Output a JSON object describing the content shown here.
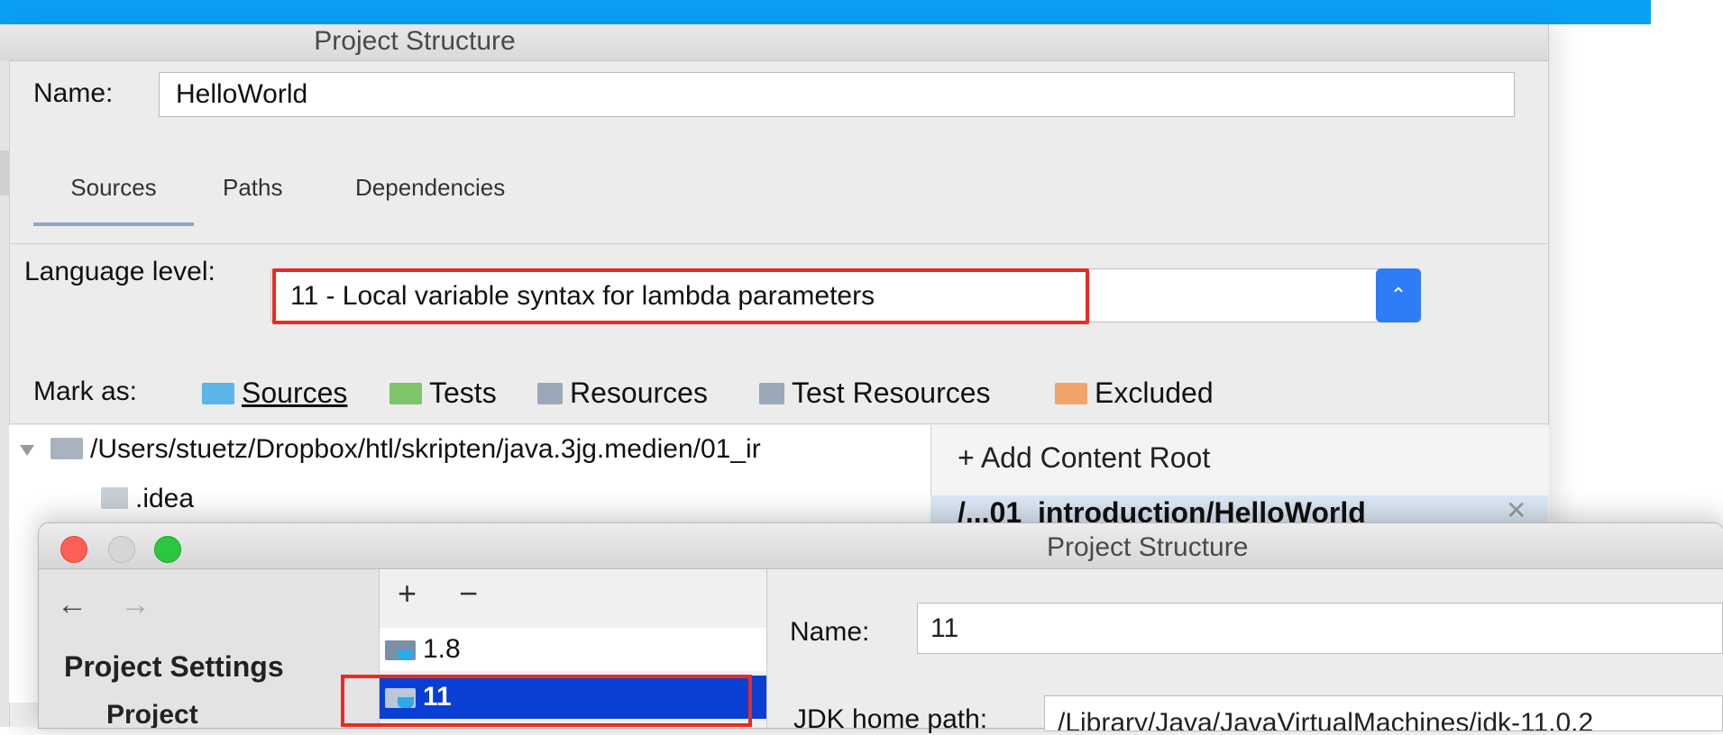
{
  "background_window": {
    "title": "Project Structure",
    "name_label": "Name:",
    "name_value": "HelloWorld",
    "tabs": [
      {
        "label": "Sources",
        "active": true
      },
      {
        "label": "Paths",
        "active": false
      },
      {
        "label": "Dependencies",
        "active": false
      }
    ],
    "language_level": {
      "label": "Language level:",
      "value": "11 - Local variable syntax for lambda parameters"
    },
    "mark_as": {
      "label": "Mark as:",
      "items": [
        {
          "label": "Sources",
          "color": "#5bb5e8"
        },
        {
          "label": "Tests",
          "color": "#7dc46a"
        },
        {
          "label": "Resources",
          "color": "#9aa8b8"
        },
        {
          "label": "Test Resources",
          "color": "#9aa8b8"
        },
        {
          "label": "Excluded",
          "color": "#f0a46a"
        }
      ]
    },
    "tree": [
      {
        "label": "/Users/stuetz/Dropbox/htl/skripten/java.3jg.medien/01_ir",
        "expanded": true
      },
      {
        "label": ".idea"
      }
    ],
    "content_root": {
      "add_label": "+ Add Content Root",
      "path": "/...01_introduction/HelloWorld",
      "remove_icon": "close-icon"
    }
  },
  "foreground_window": {
    "title": "Project Structure",
    "traffic_lights": {
      "close": "#fc5f57",
      "minimize": "#d6d6d6",
      "maximize": "#2ac840"
    },
    "nav": {
      "back": "←",
      "forward": "→",
      "section": "Project Settings",
      "item": "Project"
    },
    "sdk_list": {
      "add": "+",
      "remove": "−",
      "items": [
        {
          "label": "1.8",
          "selected": false
        },
        {
          "label": "11",
          "selected": true
        }
      ]
    },
    "details": {
      "name_label": "Name:",
      "name_value": "11",
      "jdk_home_label": "JDK home path:",
      "jdk_home_value": "/Library/Java/JavaVirtualMachines/jdk-11.0.2"
    }
  },
  "colors": {
    "accent_bar": "#0aa0f5",
    "highlight_box": "#ea2b1f",
    "selection": "#0a3fd4",
    "stepper": "#2f7df6"
  }
}
